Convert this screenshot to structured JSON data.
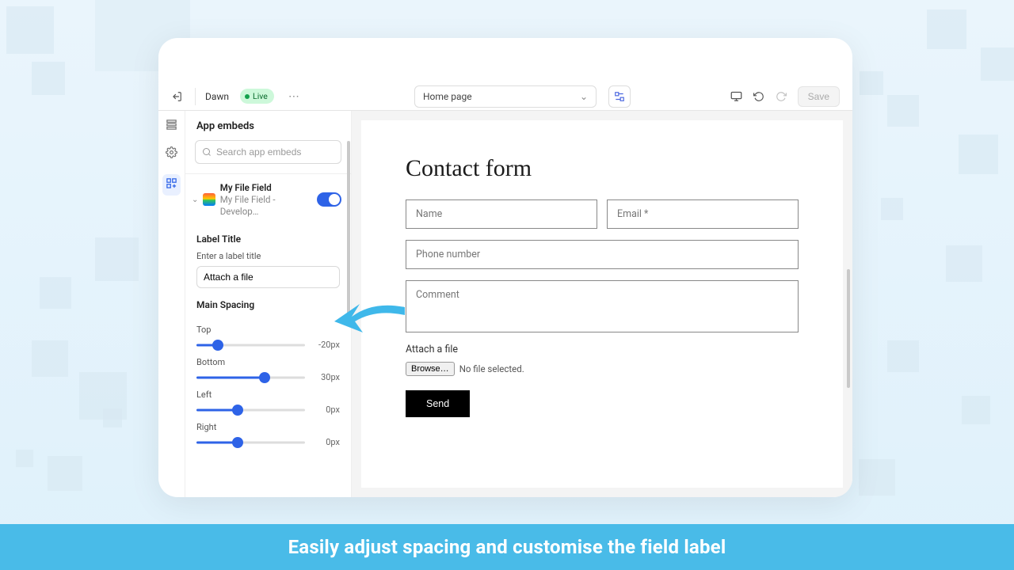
{
  "topbar": {
    "theme_name": "Dawn",
    "live_label": "Live",
    "page_selected": "Home page",
    "save_label": "Save"
  },
  "panel": {
    "title": "App embeds",
    "search_placeholder": "Search app embeds",
    "embed": {
      "name": "My File Field",
      "subtitle": "My File Field - Develop…"
    },
    "label_title_heading": "Label Title",
    "label_title_hint": "Enter a label title",
    "label_title_value": "Attach a file",
    "main_spacing_heading": "Main Spacing",
    "sliders": {
      "top": {
        "label": "Top",
        "value": "-20px",
        "percent": 20
      },
      "bottom": {
        "label": "Bottom",
        "value": "30px",
        "percent": 63
      },
      "left": {
        "label": "Left",
        "value": "0px",
        "percent": 38
      },
      "right": {
        "label": "Right",
        "value": "0px",
        "percent": 38
      }
    }
  },
  "preview": {
    "heading": "Contact form",
    "name_ph": "Name",
    "email_ph": "Email *",
    "phone_ph": "Phone number",
    "comment_ph": "Comment",
    "attach_label": "Attach a file",
    "browse_label": "Browse…",
    "no_file": "No file selected.",
    "send_label": "Send"
  },
  "banner_text": "Easily adjust spacing and customise the field label"
}
